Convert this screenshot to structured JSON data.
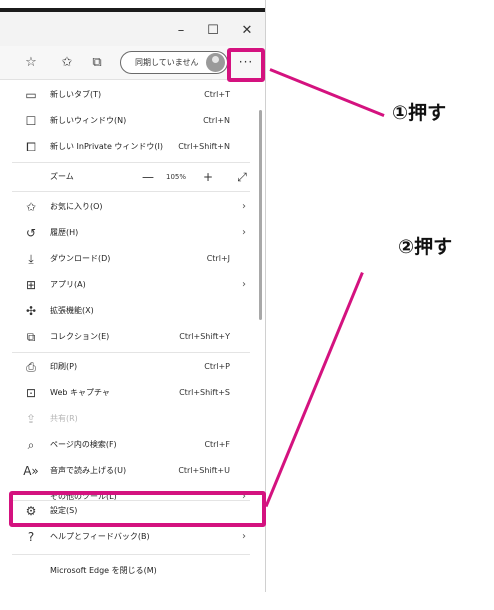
{
  "window": {
    "minimize": "–",
    "maximize": "☐",
    "close": "✕"
  },
  "toolbar": {
    "favorite_icon": "star-icon",
    "favorites_icon": "favorites-list-icon",
    "collections_icon": "collections-icon",
    "sync_label": "同期していません",
    "more_label": "···"
  },
  "menu": {
    "new_tab": {
      "label": "新しいタブ(T)",
      "shortcut": "Ctrl+T"
    },
    "new_window": {
      "label": "新しいウィンドウ(N)",
      "shortcut": "Ctrl+N"
    },
    "new_inprivate": {
      "label": "新しい InPrivate ウィンドウ(I)",
      "shortcut": "Ctrl+Shift+N"
    },
    "zoom": {
      "label": "ズーム",
      "minus": "—",
      "value": "105%",
      "plus": "+",
      "fullscreen": "⤢"
    },
    "favorites": {
      "label": "お気に入り(O)"
    },
    "history": {
      "label": "履歴(H)"
    },
    "downloads": {
      "label": "ダウンロード(D)",
      "shortcut": "Ctrl+J"
    },
    "apps": {
      "label": "アプリ(A)"
    },
    "extensions": {
      "label": "拡張機能(X)"
    },
    "collections": {
      "label": "コレクション(E)",
      "shortcut": "Ctrl+Shift+Y"
    },
    "print": {
      "label": "印刷(P)",
      "shortcut": "Ctrl+P"
    },
    "web_capture": {
      "label": "Web キャプチャ",
      "shortcut": "Ctrl+Shift+S"
    },
    "share": {
      "label": "共有(R)"
    },
    "find": {
      "label": "ページ内の検索(F)",
      "shortcut": "Ctrl+F"
    },
    "read_aloud": {
      "label": "音声で読み上げる(U)",
      "shortcut": "Ctrl+Shift+U"
    },
    "more_tools": {
      "label": "その他のツール(L)"
    },
    "settings": {
      "label": "設定(S)"
    },
    "help": {
      "label": "ヘルプとフィードバック(B)"
    },
    "close_edge": {
      "label": "Microsoft Edge を閉じる(M)"
    }
  },
  "annotations": {
    "step1": "①押す",
    "step2": "②押す",
    "highlight_color": "#d4127f"
  }
}
